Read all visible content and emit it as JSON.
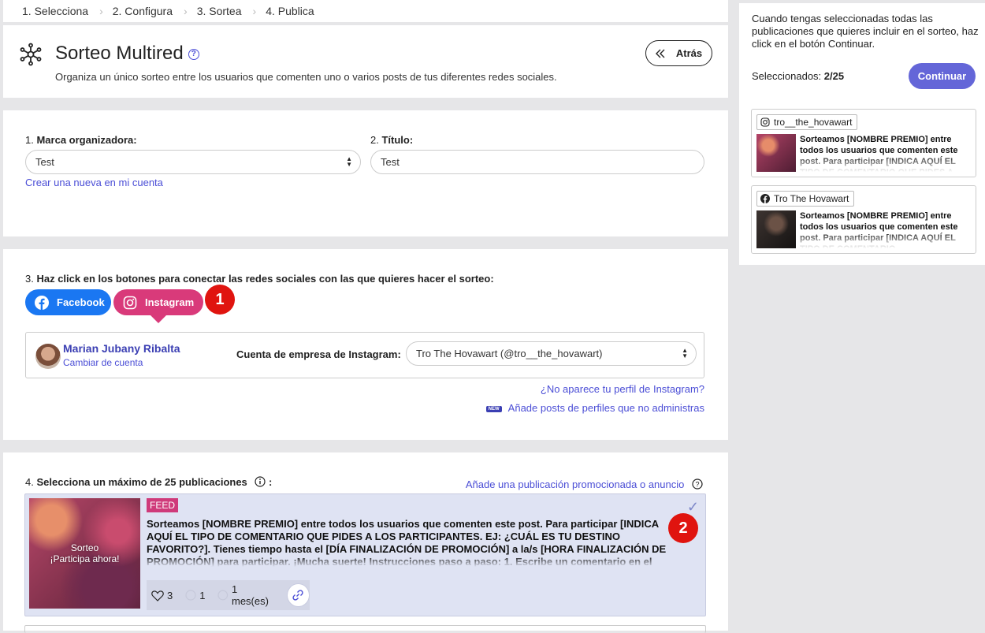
{
  "steps": [
    "1. Selecciona",
    "2. Configura",
    "3. Sortea",
    "4. Publica"
  ],
  "header": {
    "title": "Sorteo Multired",
    "subtitle": "Organiza un único sorteo entre los usuarios que comenten uno o varios posts de tus diferentes redes sociales.",
    "back_label": "Atrás"
  },
  "brand": {
    "num": "1.",
    "label": "Marca organizadora:",
    "value": "Test",
    "create_link": "Crear una nueva en mi cuenta"
  },
  "title_field": {
    "num": "2.",
    "label": "Título:",
    "value": "Test"
  },
  "networks": {
    "num": "3.",
    "label": "Haz click en los botones para conectar las redes sociales con las que quieres hacer el sorteo:",
    "facebook_label": "Facebook",
    "instagram_label": "Instagram",
    "badge1": "1",
    "account_name": "Marian Jubany Ribalta",
    "change_account": "Cambiar de cuenta",
    "business_label": "Cuenta de empresa de Instagram:",
    "business_value": "Tro The Hovawart (@tro__the_hovawart)",
    "missing_profile_link": "¿No aparece tu perfil de Instagram?",
    "new_tag": "NEW",
    "add_posts_link": "Añade posts de perfiles que no administras"
  },
  "posts_section": {
    "num": "4.",
    "label": "Selecciona un máximo de 25 publicaciones",
    "colon": ":",
    "promoted_link": "Añade una publicación promocionada o anuncio",
    "badge2": "2"
  },
  "post": {
    "tag": "FEED",
    "thumb_line1": "Sorteo",
    "thumb_line2": "¡Participa ahora!",
    "text": "Sorteamos [NOMBRE PREMIO] entre todos los usuarios que comenten este post. Para participar [INDICA AQUÍ EL TIPO DE COMENTARIO QUE PIDES A LOS PARTICIPANTES. EJ: ¿CUÁL ES TU DESTINO FAVORITO?]. Tienes tiempo hasta el [DÍA FINALIZACIÓN DE PROMOCIÓN] a la/s [HORA FINALIZACIÓN DE PROMOCIÓN] para participar. ¡Mucha suerte! Instrucciones paso a paso: 1. Escribe un comentario en el",
    "likes": "3",
    "comments": "1",
    "age": "1 mes(es)"
  },
  "sidebar": {
    "info": "Cuando tengas seleccionadas todas las publicaciones que quieres incluir en el sorteo, haz click en el botón Continuar.",
    "selected_label": "Seleccionados:",
    "selected_count": "2/25",
    "continue_label": "Continuar",
    "cards": [
      {
        "network": "instagram",
        "account": "tro__the_hovawart",
        "text": "Sorteamos [NOMBRE PREMIO] entre todos los usuarios que comenten este post. Para participar [INDICA AQUÍ EL TIPO DE COMENTARIO QUE PIDES A"
      },
      {
        "network": "facebook",
        "account": "Tro The Hovawart",
        "text": "Sorteamos [NOMBRE PREMIO] entre todos los usuarios que comenten este post. Para participar [INDICA AQUÍ EL TIPO DE COMENTARIO"
      }
    ]
  },
  "colors": {
    "accent": "#4b4ed6",
    "facebook": "#1a77f2",
    "instagram": "#d93a7a",
    "badge": "#e0140f",
    "continue": "#6466d8",
    "selected_post_bg": "#dfe3f3"
  }
}
